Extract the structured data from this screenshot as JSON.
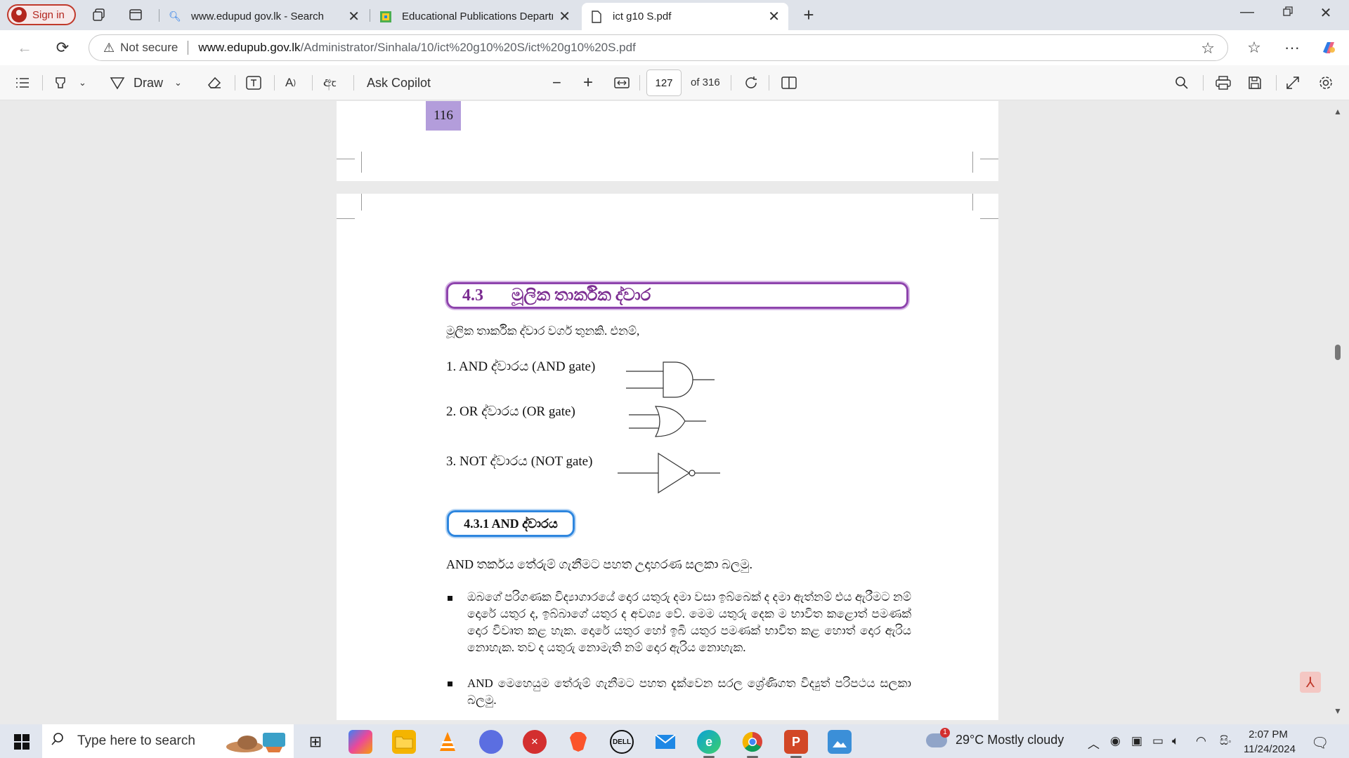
{
  "browser": {
    "sign_in": "Sign in",
    "tabs": [
      {
        "title": "www.edupud gov.lk - Search",
        "icon": "search-icon"
      },
      {
        "title": "Educational Publications Departm",
        "icon": "site-favicon"
      },
      {
        "title": "ict g10 S.pdf",
        "icon": "document-icon",
        "active": true
      }
    ],
    "security": "Not secure",
    "url_host": "www.edupub.gov.lk",
    "url_path": "/Administrator/Sinhala/10/ict%20g10%20S/ict%20g10%20S.pdf"
  },
  "pdf_toolbar": {
    "draw_label": "Draw",
    "ask_copilot": "Ask Copilot",
    "current_page": "127",
    "page_count": "of 316"
  },
  "document": {
    "prev_page_number": "116",
    "section_number": "4.3",
    "section_title": "මූලික තාර්කික ද්වාර",
    "intro": "මූලික තාර්කික ද්වාර වර්ග තුනකි. එනම්,",
    "gates": [
      {
        "label": "1.   AND ද්වාරය (AND  gate)",
        "type": "and"
      },
      {
        "label": "2.   OR ද්වාරය   (OR  gate)",
        "type": "or"
      },
      {
        "label": "3.   NOT ද්වාරය  (NOT gate)",
        "type": "not"
      }
    ],
    "subsection": "4.3.1  AND ද්වාරය",
    "and_intro": "AND  තර්කය තේරුම් ගැනීමට පහත උදාහරණ සලකා බලමු.",
    "bullets": [
      "ඔබගේ පරිගණක විද්‍යාගාරයේ දොර යතුරු දමා වසා ඉබ්බෙක් ද දමා ඇත්නම් එය ඇරීමට නම් දොරේ යතුර ද, ඉබ්බාගේ යතුර ද අවශ්‍ය වේ. මෙම යතුරු දෙක ම භාවිත කළොත් පමණක් දොර විවෘත කළ හැක. දොරේ යතුර හෝ ඉබි යතුර පමණක් භාවිත කළ හොත් දොර ඇරිය නොහැක. තව ද යතුරු නොමැති නම් දොර ඇරිය නොහැක.",
      "AND මෙහෙයුම තේරුම් ගැනීමට පහත දැක්වෙන සරල ශ්‍රේණිගත විද්‍යුත් පරිපථය සලකා බලමු."
    ]
  },
  "taskbar": {
    "search_placeholder": "Type here to search",
    "weather": "29°C  Mostly cloudy",
    "weather_badge": "1",
    "time": "2:07 PM",
    "date": "11/24/2024"
  },
  "colors": {
    "section_border": "#8e44ad",
    "subsection_border": "#2e86de",
    "page_number_bg": "#b39ddb"
  }
}
